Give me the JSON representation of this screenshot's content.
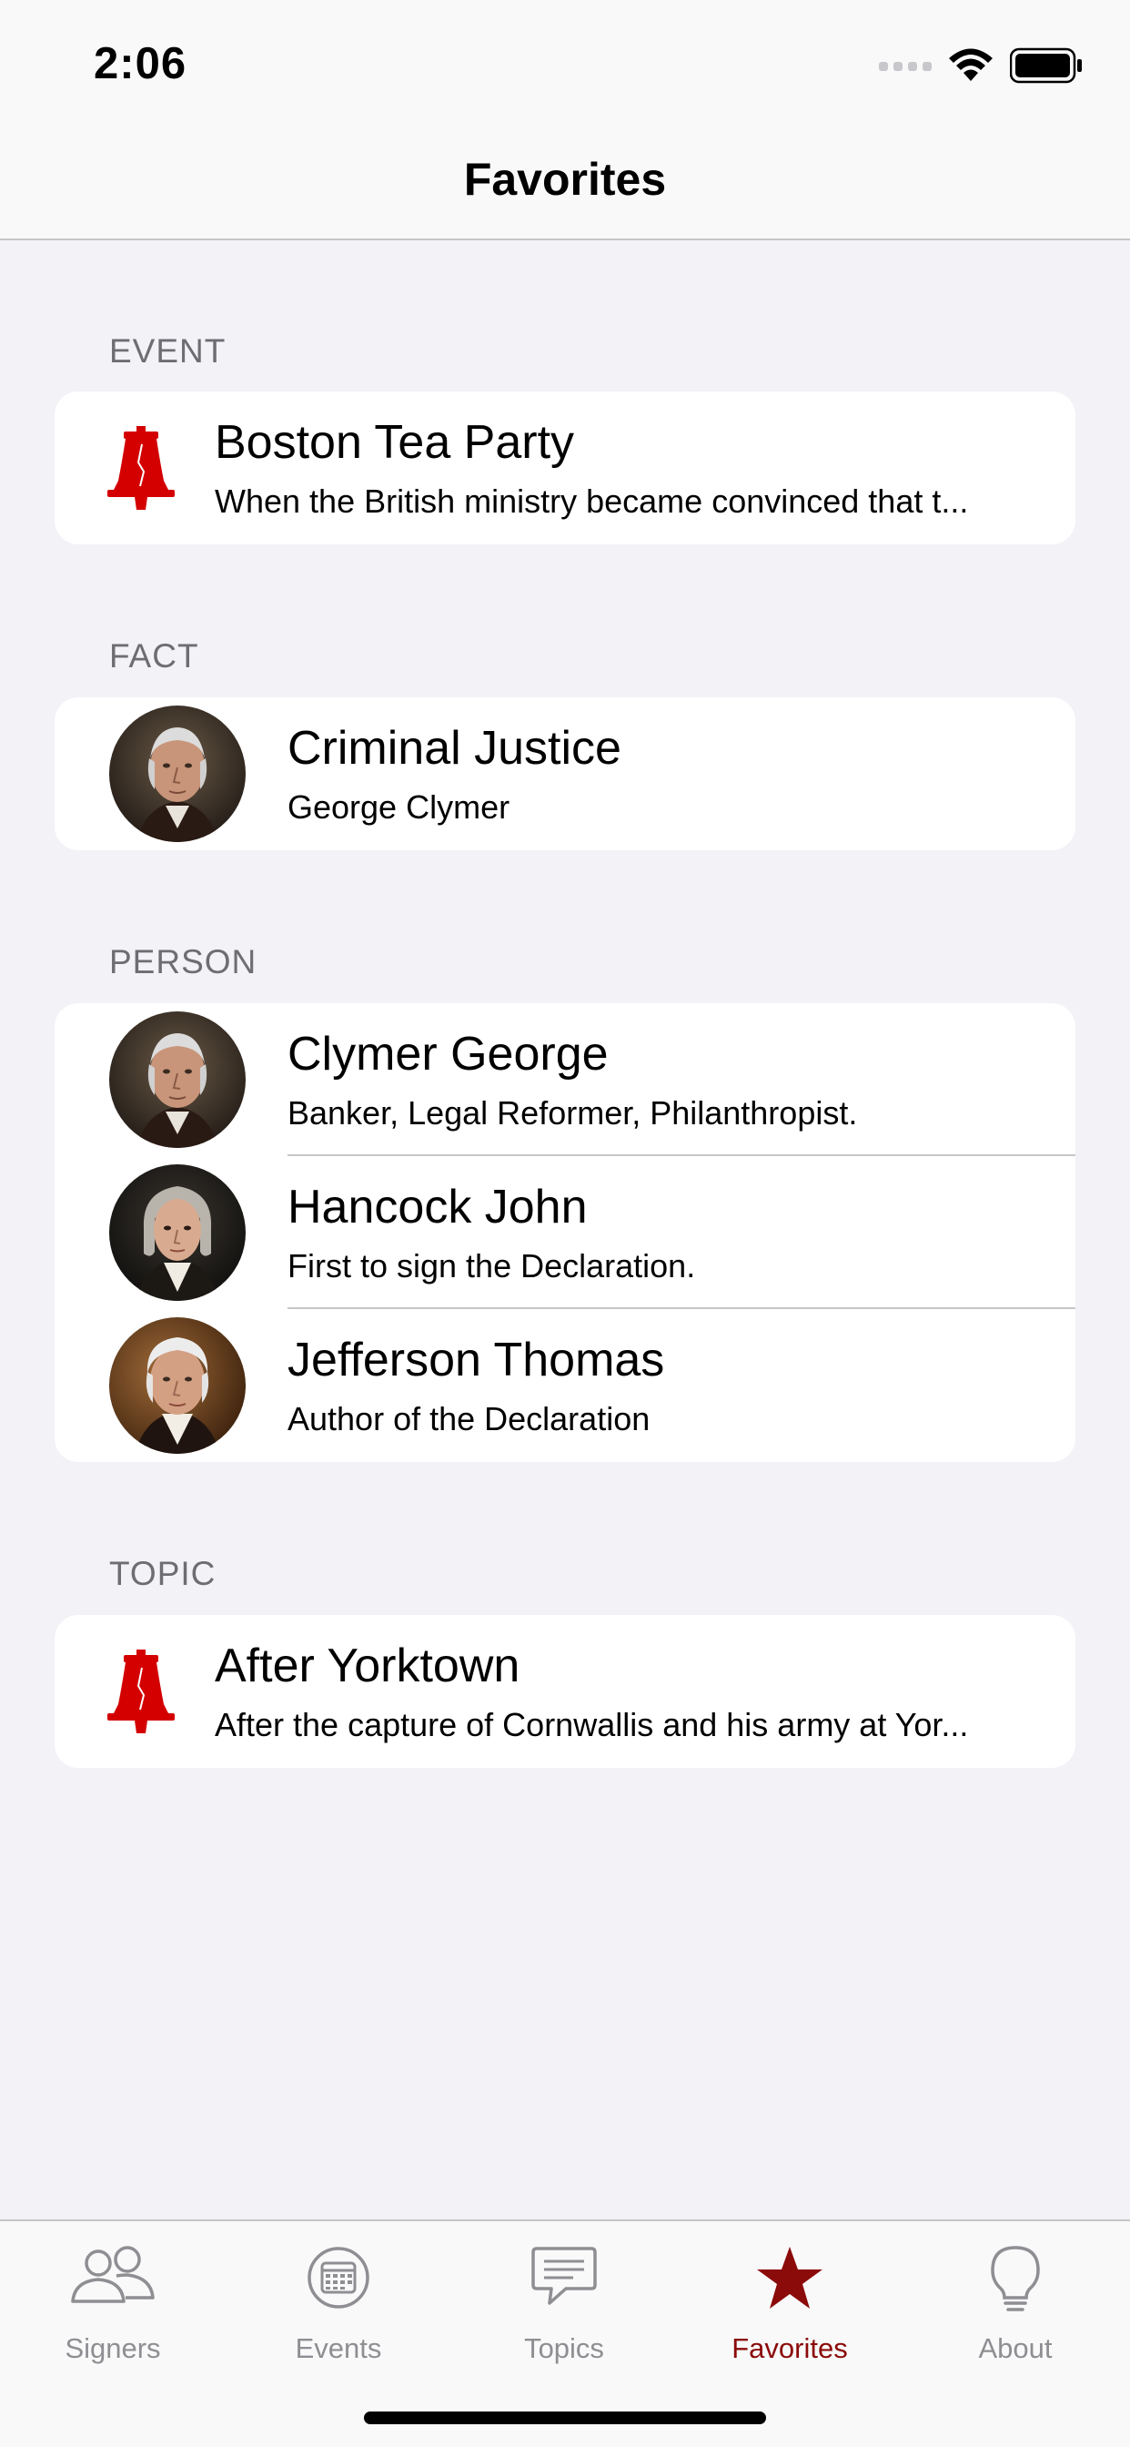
{
  "status_bar": {
    "time": "2:06"
  },
  "nav": {
    "title": "Favorites"
  },
  "sections": {
    "event": {
      "header": "EVENT",
      "items": [
        {
          "title": "Boston Tea Party",
          "subtitle": "When the British ministry became convinced that t...",
          "icon": "liberty-bell-icon"
        }
      ]
    },
    "fact": {
      "header": "FACT",
      "items": [
        {
          "title": "Criminal Justice",
          "subtitle": "George Clymer",
          "icon": "portrait-george-clymer"
        }
      ]
    },
    "person": {
      "header": "PERSON",
      "items": [
        {
          "title": "Clymer George",
          "subtitle": "Banker, Legal Reformer, Philanthropist.",
          "icon": "portrait-george-clymer"
        },
        {
          "title": "Hancock John",
          "subtitle": "First to sign the Declaration.",
          "icon": "portrait-john-hancock"
        },
        {
          "title": "Jefferson Thomas",
          "subtitle": "Author of the Declaration",
          "icon": "portrait-thomas-jefferson"
        }
      ]
    },
    "topic": {
      "header": "TOPIC",
      "items": [
        {
          "title": "After Yorktown",
          "subtitle": "After the capture of Cornwallis and his army at Yor...",
          "icon": "liberty-bell-icon"
        }
      ]
    }
  },
  "tabs": [
    {
      "label": "Signers",
      "icon": "people-icon",
      "active": false
    },
    {
      "label": "Events",
      "icon": "calendar-icon",
      "active": false
    },
    {
      "label": "Topics",
      "icon": "chat-bubble-icon",
      "active": false
    },
    {
      "label": "Favorites",
      "icon": "star-icon",
      "active": true
    },
    {
      "label": "About",
      "icon": "lightbulb-icon",
      "active": false
    }
  ],
  "colors": {
    "accent": "#8b0a0a",
    "bell_red": "#d40000",
    "background": "#f2f2f7",
    "inactive_tab": "#8e8e93"
  }
}
